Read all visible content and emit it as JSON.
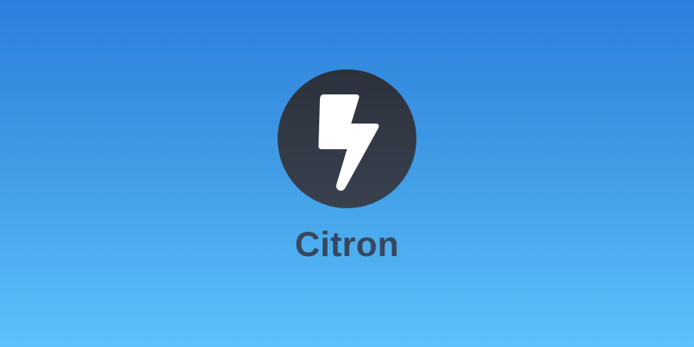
{
  "app": {
    "name": "Citron",
    "logo_icon": "lightning-bolt-icon"
  },
  "colors": {
    "background_top": "#2c80dd",
    "background_bottom": "#5bc2fb",
    "logo_circle": "#333a46",
    "logo_bolt": "#ffffff",
    "title_text": "#38475e"
  }
}
